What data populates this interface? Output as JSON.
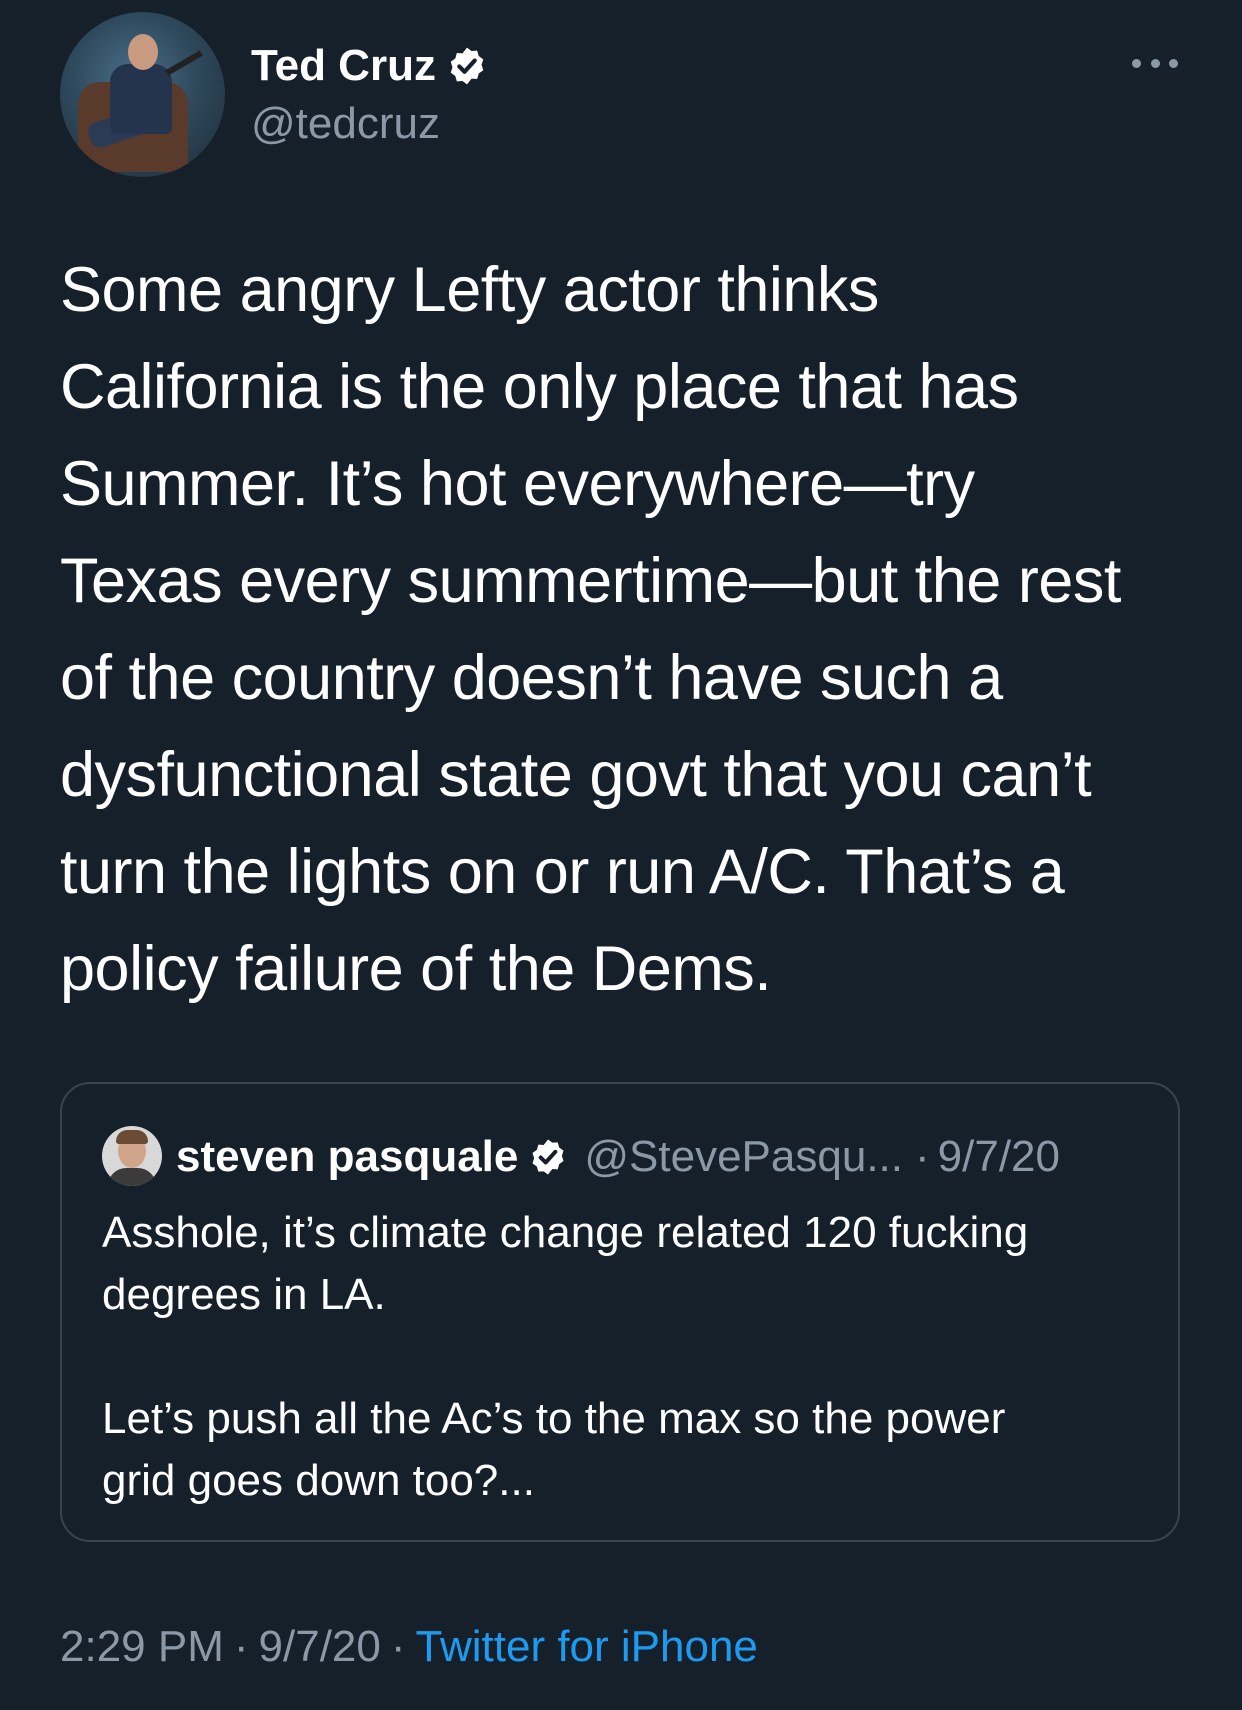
{
  "tweet": {
    "author": {
      "name": "Ted Cruz",
      "handle": "@tedcruz",
      "verified": true
    },
    "text": "Some angry Lefty actor thinks\nCalifornia is the only place that has\nSummer. It’s hot everywhere—try\nTexas every summertime—but the rest\nof the country doesn’t have such a\ndysfunctional state govt that you can’t\nturn the lights on or run A/C. That’s a\npolicy failure of the Dems.",
    "quoted": {
      "name": "steven pasquale",
      "handle": "@StevePasqu...",
      "separator": "·",
      "date": "9/7/20",
      "verified": true,
      "text": "Asshole, it’s climate change related 120 fucking\ndegrees in LA.\n\nLet’s push all the Ac’s to the max so the power\ngrid goes down too?..."
    },
    "meta": {
      "time": "2:29 PM",
      "separator": "·",
      "date": "9/7/20",
      "source": "Twitter for iPhone"
    }
  },
  "icons": {
    "more": "more-horizontal-icon",
    "verified": "verified-badge-icon"
  },
  "colors": {
    "background": "#15202b",
    "primary_text": "#ffffff",
    "secondary_text": "#8b98a5",
    "link": "#1d9bf0",
    "border": "#38444d"
  }
}
